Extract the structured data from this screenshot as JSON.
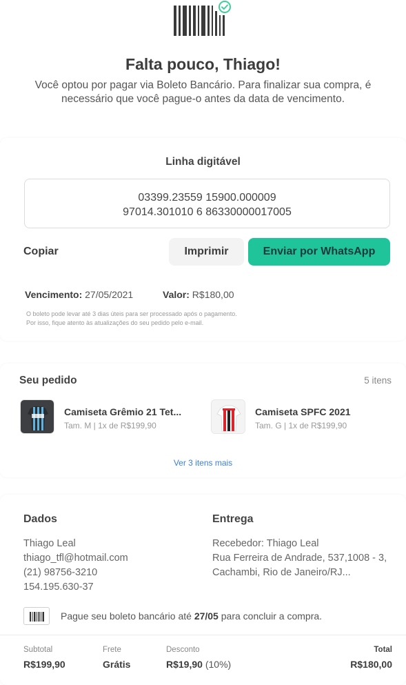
{
  "header": {
    "title": "Falta pouco, Thiago!",
    "subtitle_line1": "Você optou por pagar via Boleto Bancário. Para finalizar sua compra, é",
    "subtitle_line2": "necessário que você pague-o antes da data de vencimento."
  },
  "boleto": {
    "title": "Linha digitável",
    "code_line1": "03399.23559 15900.000009",
    "code_line2": "97014.301010 6 86330000017005",
    "copy_label": "Copiar",
    "print_label": "Imprimir",
    "whatsapp_label": "Enviar por WhatsApp",
    "due_label": "Vencimento:",
    "due_value": "27/05/2021",
    "value_label": "Valor:",
    "value_value": "R$180,00",
    "fine_line1": "O boleto pode levar até 3 dias úteis para ser processado após o pagamento.",
    "fine_line2": "Por isso, fique atento às atualizações do seu pedido pelo e-mail."
  },
  "order": {
    "title": "Seu pedido",
    "count": "5 itens",
    "items": [
      {
        "name": "Camiseta Grêmio 21 Tet...",
        "meta": "Tam. M | 1x de R$199,90"
      },
      {
        "name": "Camiseta SPFC 2021",
        "meta": "Tam. G | 1x de R$199,90"
      }
    ],
    "more_link": "Ver 3 itens mais"
  },
  "details": {
    "dados_title": "Dados",
    "dados_lines": [
      "Thiago Leal",
      "thiago_tfl@hotmail.com",
      "(21) 98756-3210",
      "154.195.630-37"
    ],
    "entrega_title": "Entrega",
    "entrega_lines": [
      "Recebedor: Thiago Leal",
      "Rua Ferreira de Andrade, 537,1008 - 3,",
      "Cachambi, Rio de Janeiro/RJ..."
    ],
    "notice_pre": "Pague seu boleto bancário até ",
    "notice_date": "27/05",
    "notice_post": " para concluir a compra."
  },
  "summary": {
    "subtotal_label": "Subtotal",
    "subtotal_value": "R$199,90",
    "frete_label": "Frete",
    "frete_value": "Grátis",
    "desconto_label": "Desconto",
    "desconto_value": "R$19,90",
    "desconto_pct": "(10%)",
    "total_label": "Total",
    "total_value": "R$180,00"
  },
  "colors": {
    "accent": "#1fc49b",
    "link": "#3a7fd6",
    "check": "#3ecf9a"
  }
}
